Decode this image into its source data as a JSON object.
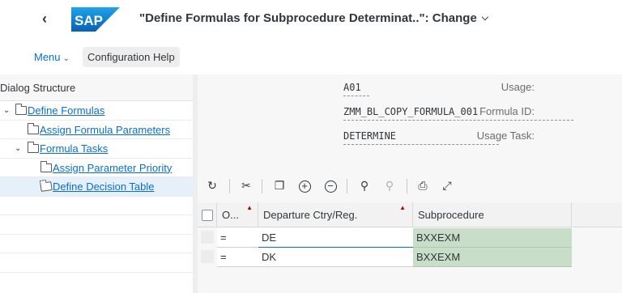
{
  "header": {
    "back_icon": "chevron-left-icon",
    "logo_text": "SAP",
    "title": "\"Define Formulas for Subprocedure Determinat..\": Change",
    "brand_color": "#0a6ed1"
  },
  "toolbar": {
    "menu_label": "Menu",
    "config_help_label": "Configuration Help"
  },
  "tree": {
    "title": "Dialog Structure",
    "items": [
      {
        "label": "Define Formulas",
        "level": 0,
        "expanded": true
      },
      {
        "label": "Assign Formula Parameters",
        "level": 1,
        "expanded": false
      },
      {
        "label": "Formula Tasks",
        "level": 1,
        "expanded": true
      },
      {
        "label": "Assign Parameter Priority",
        "level": 2,
        "expanded": false
      },
      {
        "label": "Define Decision Table",
        "level": 2,
        "expanded": false,
        "selected": true
      }
    ]
  },
  "form": {
    "usage_label": "Usage:",
    "usage_value": "A01",
    "formula_id_label": "Formula ID:",
    "formula_id_value": "ZMM_BL_COPY_FORMULA_001",
    "usage_task_label": "Usage Task:",
    "usage_task_value": "DETERMINE"
  },
  "table_toolbar": {
    "buttons": [
      "refresh-icon",
      "cut-icon",
      "copy-icon",
      "add-icon",
      "remove-icon",
      "search-icon",
      "search-next-icon",
      "print-icon",
      "fullscreen-icon"
    ]
  },
  "table": {
    "columns": [
      "O...",
      "Departure Ctry/Reg.",
      "Subprocedure"
    ],
    "rows": [
      {
        "operator": "=",
        "departure": "DE",
        "subprocedure": "BXXEXM"
      },
      {
        "operator": "=",
        "departure": "DK",
        "subprocedure": "BXXEXM"
      }
    ],
    "result_color": "#c9dec9"
  }
}
